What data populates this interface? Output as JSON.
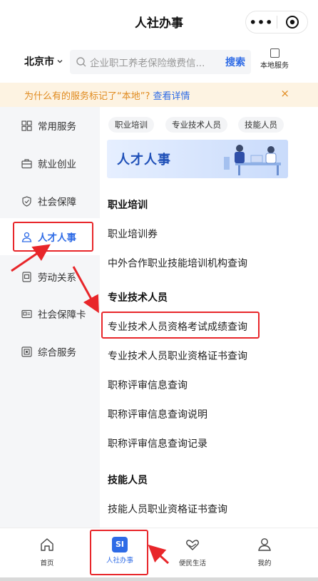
{
  "header": {
    "title": "人社办事",
    "more_icon": "more-dots-icon",
    "close_icon": "target-icon"
  },
  "search": {
    "city": "北京市",
    "placeholder": "企业职工养老保险缴费信...",
    "button": "搜索",
    "local_service": "本地服务"
  },
  "notice": {
    "text": "为什么有的服务标记了“本地”?",
    "link": "查看详情",
    "close": "×"
  },
  "sidebar": {
    "items": [
      {
        "label": "常用服务",
        "icon": "grid-icon"
      },
      {
        "label": "就业创业",
        "icon": "briefcase-icon"
      },
      {
        "label": "社会保障",
        "icon": "shield-icon"
      },
      {
        "label": "人才人事",
        "icon": "person-icon"
      },
      {
        "label": "劳动关系",
        "icon": "document-icon"
      },
      {
        "label": "社会保障卡",
        "icon": "card-icon"
      },
      {
        "label": "综合服务",
        "icon": "service-icon"
      }
    ],
    "active_index": 3
  },
  "content": {
    "tags": [
      "职业培训",
      "专业技术人员",
      "技能人员"
    ],
    "banner_title": "人才人事",
    "sections": [
      {
        "title": "职业培训",
        "items": [
          "职业培训券",
          "中外合作职业技能培训机构查询"
        ]
      },
      {
        "title": "专业技术人员",
        "items": [
          "专业技术人员资格考试成绩查询",
          "专业技术人员职业资格证书查询",
          "职称评审信息查询",
          "职称评审信息查询说明",
          "职称评审信息查询记录"
        ]
      },
      {
        "title": "技能人员",
        "items": [
          "技能人员职业资格证书查询"
        ]
      }
    ]
  },
  "tabbar": {
    "items": [
      {
        "label": "首页",
        "icon": "home-icon"
      },
      {
        "label": "人社办事",
        "icon": "si-icon",
        "badge": "SI"
      },
      {
        "label": "便民生活",
        "icon": "heart-hand-icon"
      },
      {
        "label": "我的",
        "icon": "user-icon"
      }
    ],
    "active_index": 1
  },
  "colors": {
    "accent": "#2e6be6",
    "notice_text": "#e08a1e",
    "annotation": "#e8262a"
  }
}
